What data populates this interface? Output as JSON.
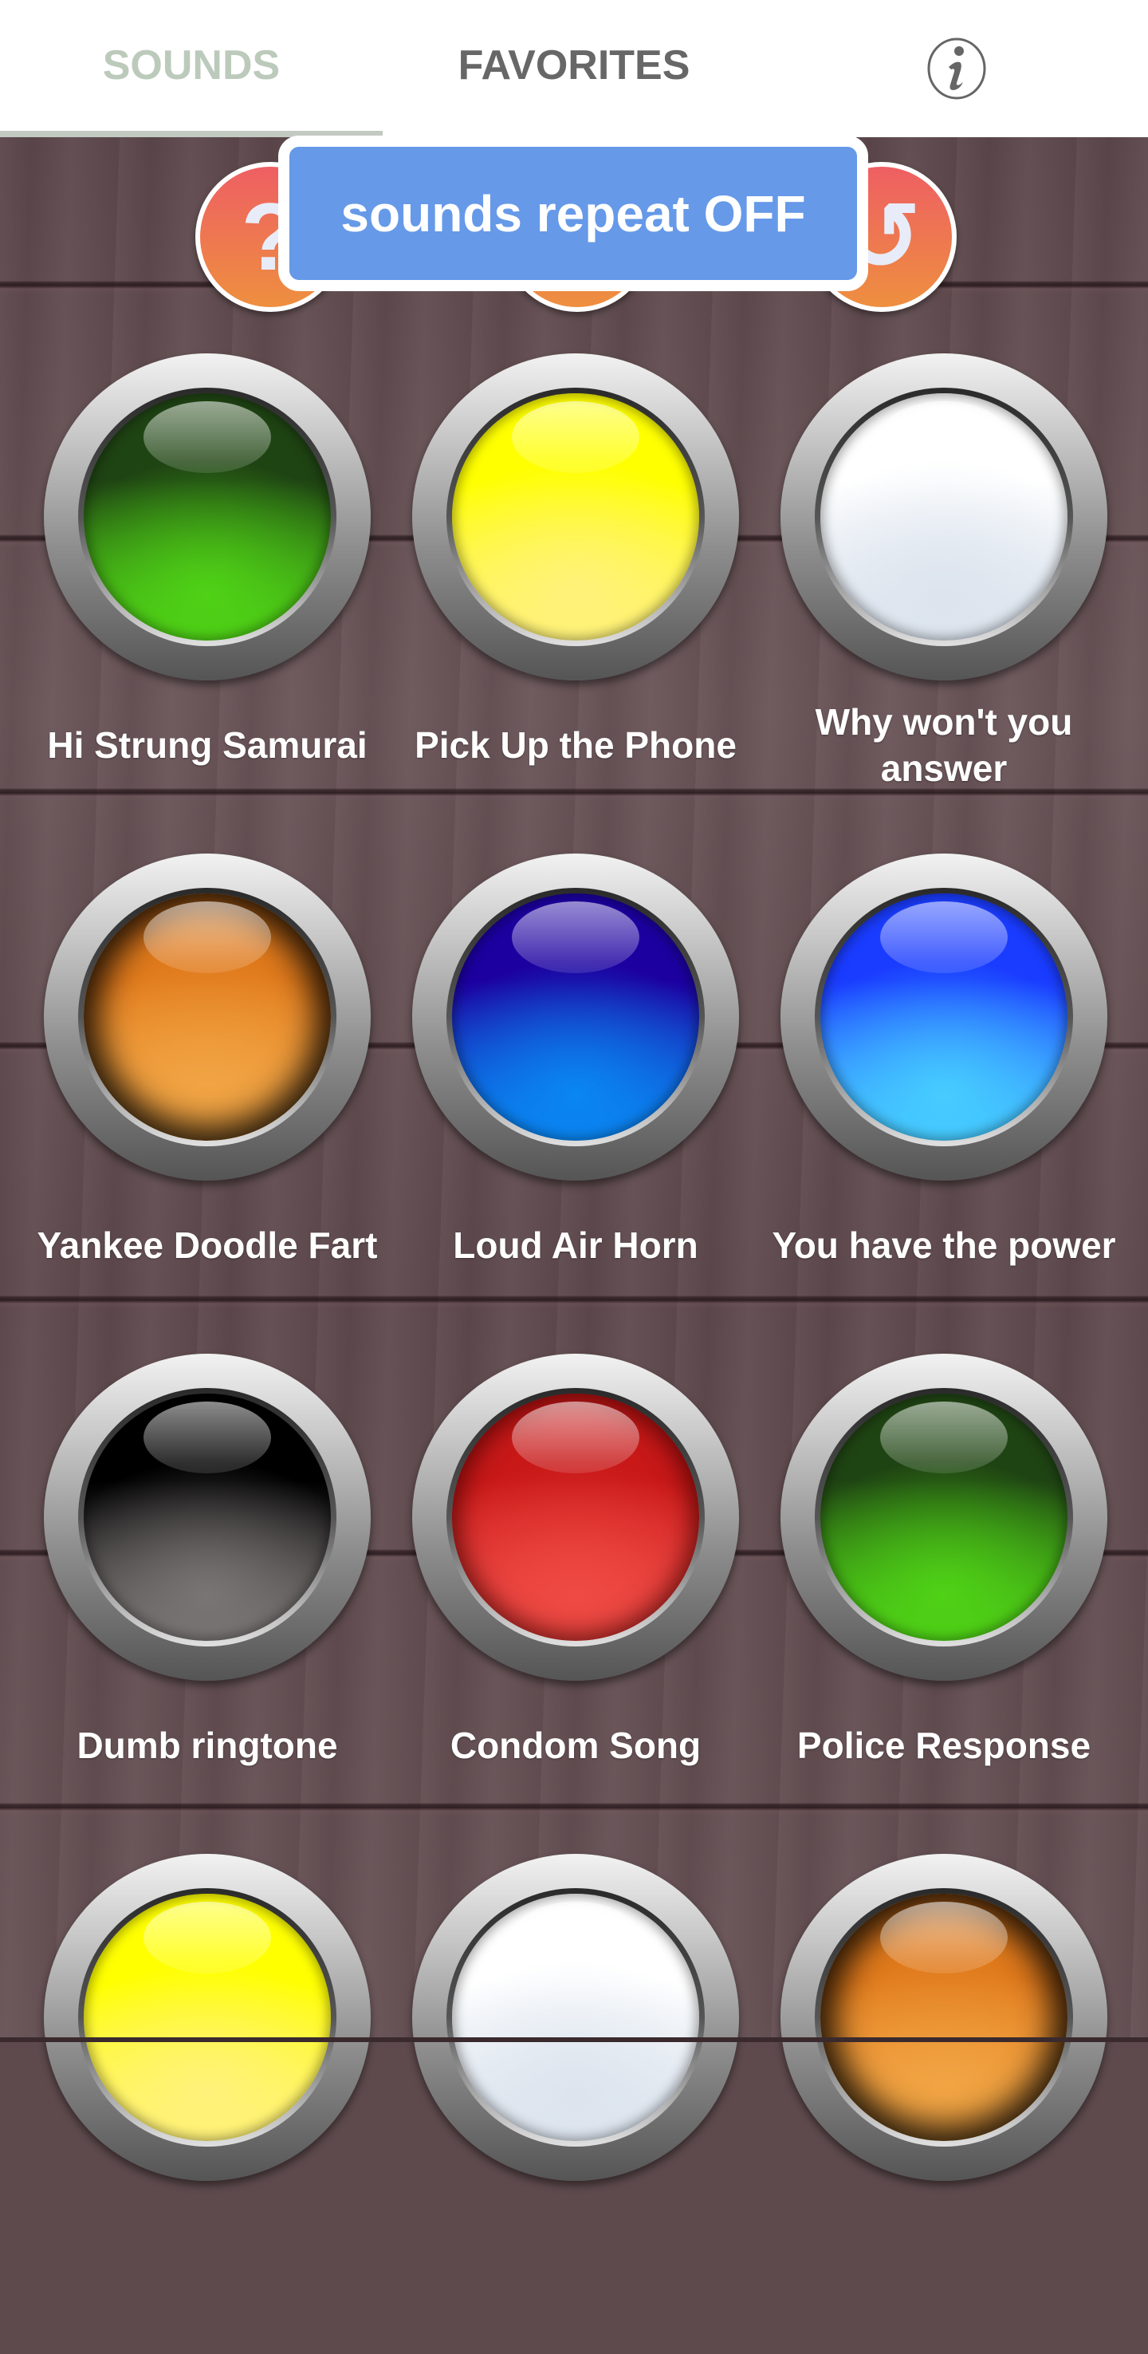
{
  "header": {
    "tabs": [
      {
        "label": "SOUNDS",
        "active": true
      },
      {
        "label": "FAVORITES",
        "active": false
      }
    ],
    "info_icon": "info-icon",
    "colors": {
      "active_tab": "#bccabc",
      "inactive_tab": "#676767",
      "indicator": "#c2cac2"
    }
  },
  "toolbar": {
    "buttons": [
      {
        "name": "help",
        "glyph": "?",
        "icon": "question-mark-icon"
      },
      {
        "name": "middle",
        "glyph": "",
        "icon": "hidden-icon"
      },
      {
        "name": "repeat",
        "glyph": "↺",
        "icon": "repeat-icon"
      }
    ],
    "gradient": [
      "#ee5f63",
      "#ee8f3f"
    ]
  },
  "toast": {
    "text": "sounds repeat OFF",
    "color": "#6699e8"
  },
  "sounds": [
    {
      "label": "Hi Strung Samurai",
      "color": "green",
      "c1": "#1f4413",
      "c2": "#4fd216"
    },
    {
      "label": "Pick Up the Phone",
      "color": "yellow",
      "c1": "#ffff00",
      "c2": "#fff27a"
    },
    {
      "label": "Why won't you answer",
      "color": "white",
      "c1": "#ffffff",
      "c2": "#dce4ee"
    },
    {
      "label": "Yankee Doodle Fart",
      "color": "orange",
      "c1": "#e07a1c",
      "c2": "#f2a544"
    },
    {
      "label": "Loud Air Horn",
      "color": "dark-blue",
      "c1": "#1c00a0",
      "c2": "#0a86f2"
    },
    {
      "label": "You have the power",
      "color": "light-blue",
      "c1": "#1a3cff",
      "c2": "#46ccff"
    },
    {
      "label": "Dumb ringtone",
      "color": "black",
      "c1": "#000000",
      "c2": "#7a7575"
    },
    {
      "label": "Condom Song",
      "color": "red",
      "c1": "#c81818",
      "c2": "#f04a44"
    },
    {
      "label": "Police Response",
      "color": "green",
      "c1": "#1f4413",
      "c2": "#4fd216"
    },
    {
      "label": "",
      "color": "yellow",
      "c1": "#ffff00",
      "c2": "#fff27a"
    },
    {
      "label": "",
      "color": "white",
      "c1": "#ffffff",
      "c2": "#dce4ee"
    },
    {
      "label": "",
      "color": "orange",
      "c1": "#e07a1c",
      "c2": "#f2a544"
    }
  ]
}
